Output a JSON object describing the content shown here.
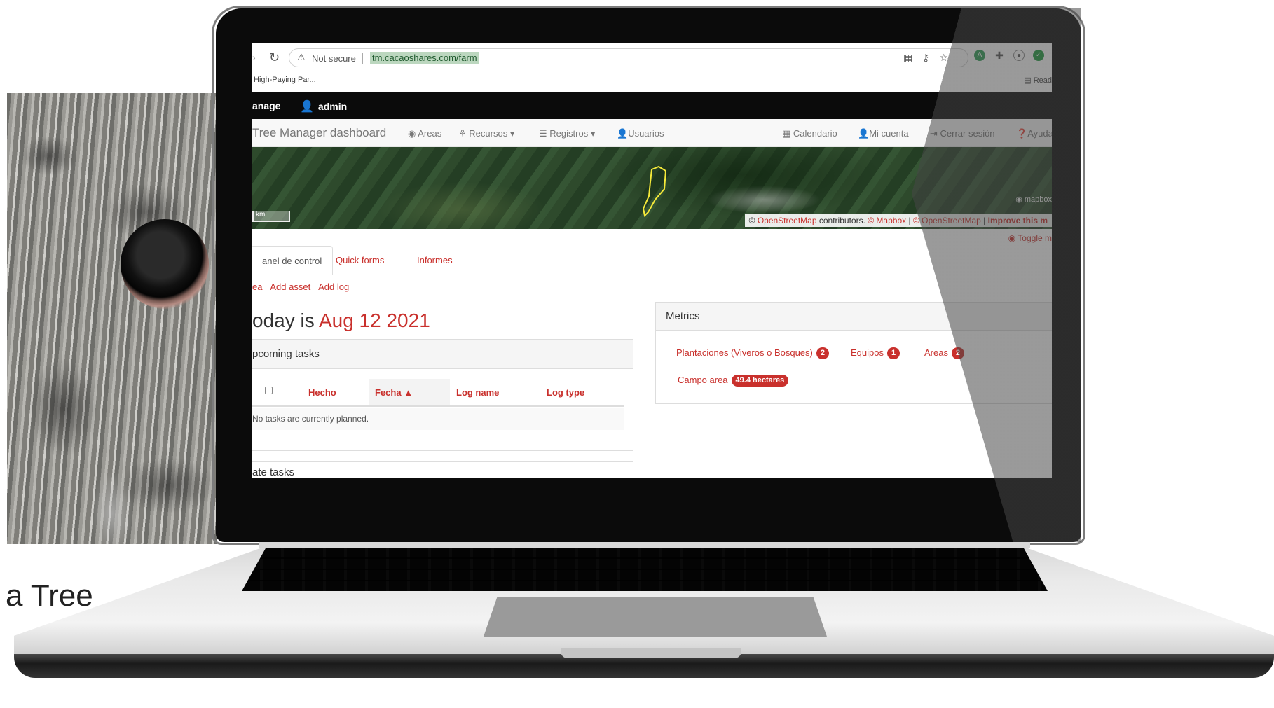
{
  "caption": "a Tree",
  "browser": {
    "not_secure": "Not secure",
    "url": "tm.cacaoshares.com/farm",
    "bookmark": "High-Paying Par...",
    "reading_list": "Read"
  },
  "topbar": {
    "manage": "anage",
    "user": "admin"
  },
  "nav": {
    "brand": "Tree Manager dashboard",
    "areas": "Areas",
    "recursos": "Recursos",
    "registros": "Registros",
    "usuarios": "Usuarios",
    "calendario": "Calendario",
    "mi_cuenta": "Mi cuenta",
    "cerrar_sesion": "Cerrar sesión",
    "ayuda": "Ayuda"
  },
  "map": {
    "scale": "km",
    "attribution": {
      "prefix": "©",
      "osm1": "OpenStreetMap",
      "contributors": "contributors.",
      "mapbox": "© Mapbox",
      "pipe": "|",
      "osm2": "© OpenStreetMap",
      "improve": "Improve this m"
    },
    "logo": "mapbox",
    "toggle": "Toggle m"
  },
  "tabs": [
    "anel de control",
    "Quick forms",
    "Informes"
  ],
  "actions": [
    "ea",
    "Add asset",
    "Add log"
  ],
  "today": {
    "prefix": "oday is",
    "date": "Aug 12 2021"
  },
  "tasks": {
    "title": "pcoming tasks",
    "columns": [
      "Hecho",
      "Fecha",
      "Log name",
      "Log type"
    ],
    "empty": "No tasks are currently planned."
  },
  "next_panel_title": "ate tasks",
  "metrics": {
    "title": "Metrics",
    "items": [
      {
        "label": "Plantaciones (Viveros o Bosques)",
        "count": "2"
      },
      {
        "label": "Equipos",
        "count": "1"
      },
      {
        "label": "Areas",
        "count": "2"
      },
      {
        "label": "Campo area",
        "count": "49.4 hectares"
      }
    ]
  },
  "colors": {
    "accent": "#c9302c",
    "topbar": "#0b0b0b"
  }
}
